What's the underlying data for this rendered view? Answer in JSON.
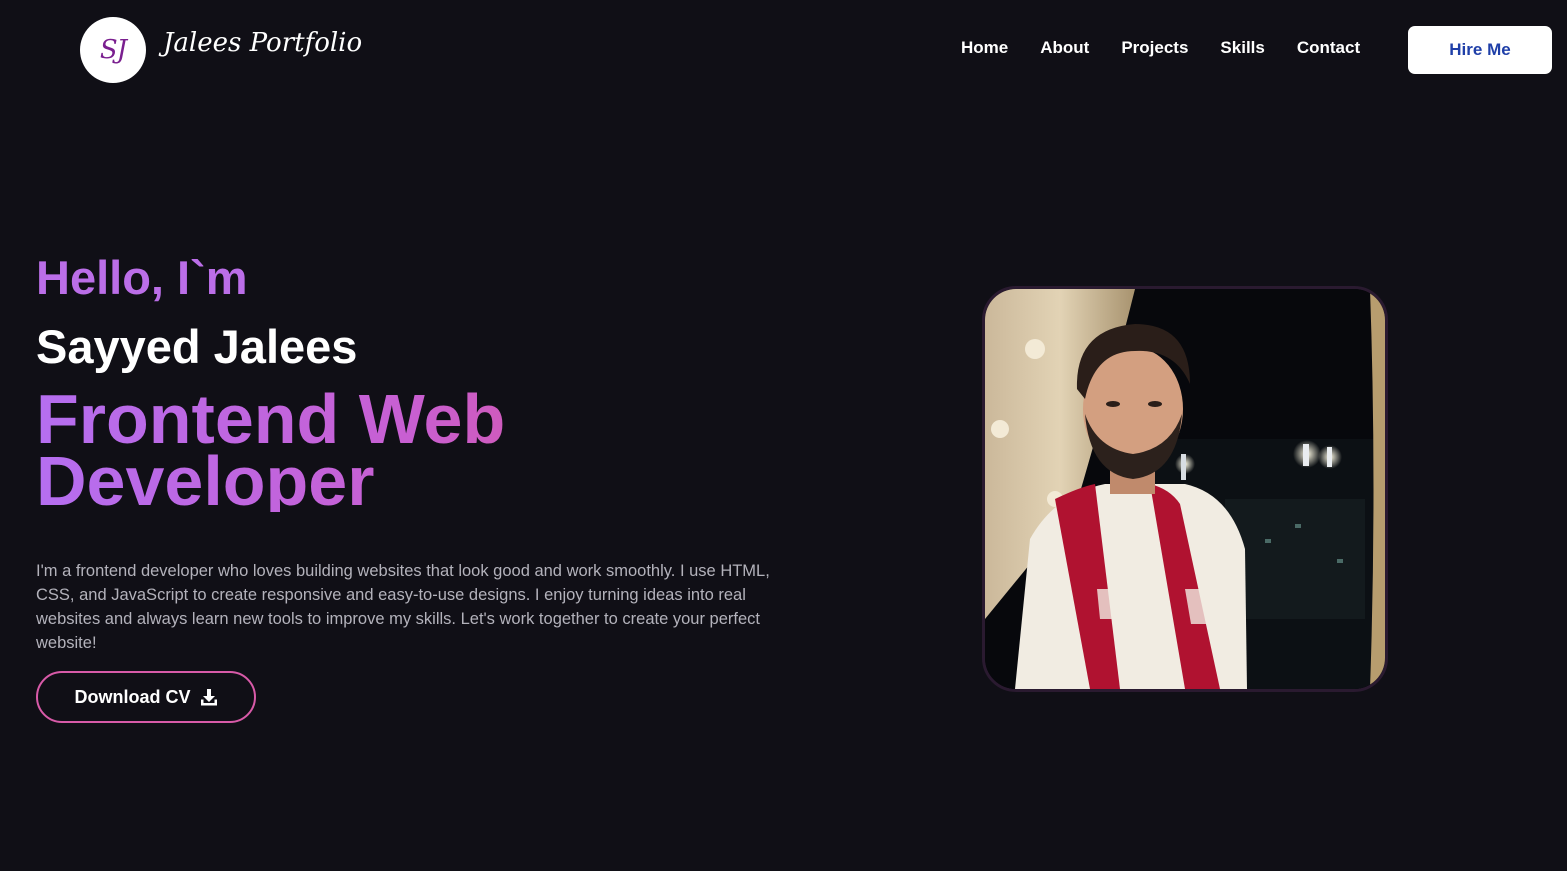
{
  "header": {
    "logo_initials": "SJ",
    "brand_name": "Jalees Portfolio",
    "nav": [
      {
        "label": "Home"
      },
      {
        "label": "About"
      },
      {
        "label": "Projects"
      },
      {
        "label": "Skills"
      },
      {
        "label": "Contact"
      }
    ],
    "hire_label": "Hire Me"
  },
  "hero": {
    "greeting": "Hello, I`m",
    "name": "Sayyed Jalees",
    "role": "Frontend Web Developer",
    "bio": "I'm a frontend developer who loves building websites that look good and work smoothly. I use HTML, CSS, and JavaScript to create responsive and easy-to-use designs. I enjoy turning ideas into real websites and always learn new tools to improve my skills. Let's work together to create your perfect website!",
    "cv_label": "Download CV",
    "cv_icon": "download-icon"
  },
  "colors": {
    "background": "#100f16",
    "accent_purple": "#bb6ee8",
    "accent_pink": "#d9549e",
    "hire_text": "#1f3fa8"
  }
}
